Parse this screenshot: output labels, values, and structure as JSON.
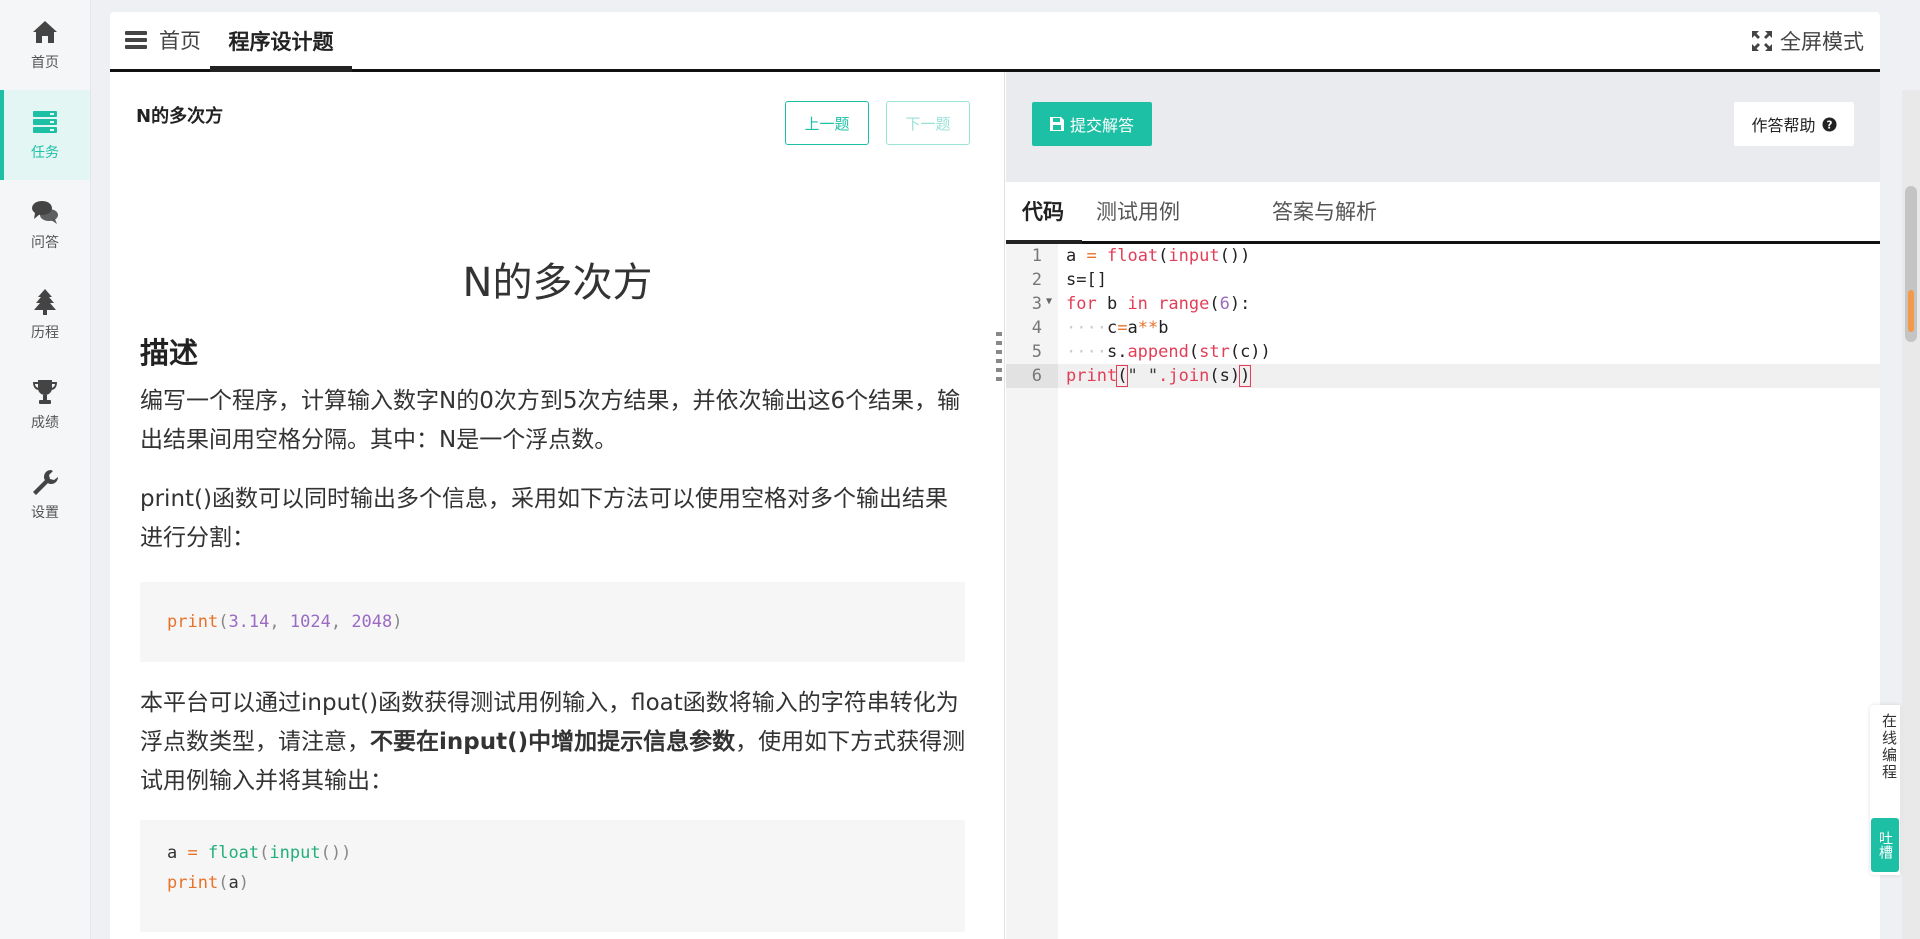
{
  "sidebar": {
    "items": [
      {
        "label": "首页",
        "icon": "home-icon"
      },
      {
        "label": "任务",
        "icon": "tasks-icon"
      },
      {
        "label": "问答",
        "icon": "comments-icon"
      },
      {
        "label": "历程",
        "icon": "tree-icon"
      },
      {
        "label": "成绩",
        "icon": "trophy-icon"
      },
      {
        "label": "设置",
        "icon": "wrench-icon"
      }
    ],
    "active_index": 1
  },
  "tabs": {
    "home": "首页",
    "task": "程序设计题",
    "fullscreen": "全屏模式"
  },
  "problem": {
    "header": "N的多次方",
    "prev_label": "上一题",
    "next_label": "下一题",
    "title": "N的多次方",
    "section": "描述",
    "para1": "编写一个程序，计算输入数字N的0次方到5次方结果，并依次输出这6个结果，输出结果间用空格分隔。其中：N是一个浮点数。",
    "para2": "print()函数可以同时输出多个信息，采用如下方法可以使用空格对多个输出结果进行分割：",
    "para3_a": "本平台可以通过input()函数获得测试用例输入，float函数将输入的字符串转化为浮点数类型，请注意，",
    "para3_bold": "不要在input()中增加提示信息参数",
    "para3_b": "，使用如下方式获得测试用例输入并将其输出：",
    "code1": {
      "fn": "print",
      "open": "(",
      "n1": "3.14",
      "sep1": ", ",
      "n2": "1024",
      "sep2": ", ",
      "n3": "2048",
      "close": ")"
    },
    "code2": {
      "l1_var": "a",
      "l1_eq": " = ",
      "l1_fn": "float",
      "l1_open": "(",
      "l1_fn2": "input",
      "l1_close": "())",
      "l2_fn": "print",
      "l2_open": "(",
      "l2_arg": "a",
      "l2_close": ")"
    }
  },
  "editor": {
    "submit_label": "提交解答",
    "help_label": "作答帮助",
    "tabs": [
      "代码",
      "测试用例",
      "答案与解析"
    ],
    "line_numbers": [
      "1",
      "2",
      "3",
      "4",
      "5",
      "6"
    ],
    "lines": {
      "l1": {
        "a": "a ",
        "eq": "=",
        "sp": " ",
        "float": "float",
        "open": "(",
        "input": "input",
        "close": "())"
      },
      "l2": {
        "text": "s=[]"
      },
      "l3": {
        "for": "for",
        "mid": " b ",
        "in": "in",
        "sp": " ",
        "range": "range",
        "open": "(",
        "num": "6",
        "close": "):"
      },
      "l4": {
        "ws": "····",
        "c": "c",
        "eq": "=",
        "a": "a",
        "op": "**",
        "b": "b"
      },
      "l5": {
        "ws": "····",
        "s": "s.",
        "append": "append",
        "open": "(",
        "str": "str",
        "inner": "(c))"
      },
      "l6": {
        "print": "print",
        "open": "(",
        "str": "\" \"",
        "join": ".join",
        "inner": "(s)",
        "close": ")"
      }
    }
  },
  "floating": {
    "feedback_text": "在线编程",
    "feedback_button": "吐槽"
  },
  "colors": {
    "accent": "#1ec0a5",
    "keyword": "#e23e57",
    "number": "#9b6bc2",
    "function": "#e8722a"
  }
}
